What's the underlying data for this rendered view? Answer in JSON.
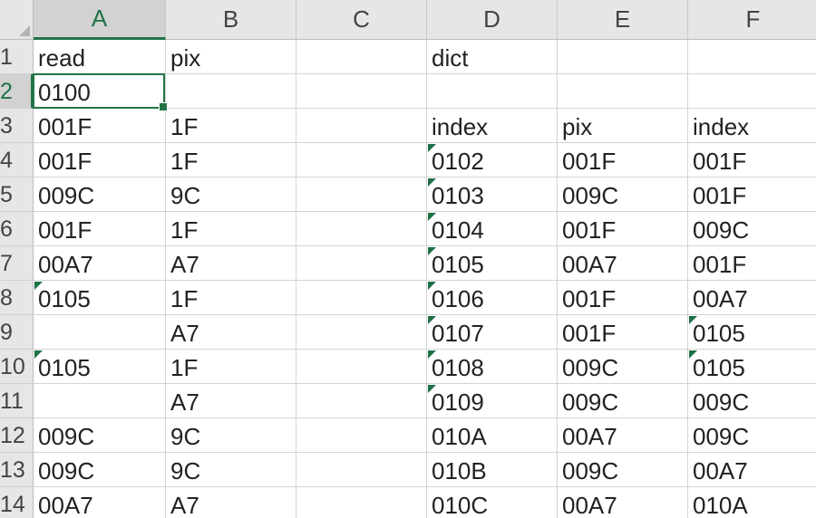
{
  "columns": [
    {
      "label": "A",
      "width": 146,
      "active": true
    },
    {
      "label": "B",
      "width": 144,
      "active": false
    },
    {
      "label": "C",
      "width": 144,
      "active": false
    },
    {
      "label": "D",
      "width": 144,
      "active": false
    },
    {
      "label": "E",
      "width": 144,
      "active": false
    },
    {
      "label": "F",
      "width": 144,
      "active": false
    }
  ],
  "rows": [
    {
      "num": "1",
      "active": false,
      "cells": [
        {
          "v": "read"
        },
        {
          "v": "pix"
        },
        {
          "v": ""
        },
        {
          "v": "dict"
        },
        {
          "v": ""
        },
        {
          "v": ""
        }
      ]
    },
    {
      "num": "2",
      "active": true,
      "cells": [
        {
          "v": "0100"
        },
        {
          "v": ""
        },
        {
          "v": ""
        },
        {
          "v": ""
        },
        {
          "v": ""
        },
        {
          "v": ""
        }
      ]
    },
    {
      "num": "3",
      "active": false,
      "cells": [
        {
          "v": "001F"
        },
        {
          "v": "1F"
        },
        {
          "v": ""
        },
        {
          "v": "index"
        },
        {
          "v": "pix"
        },
        {
          "v": "index"
        }
      ]
    },
    {
      "num": "4",
      "active": false,
      "cells": [
        {
          "v": "001F"
        },
        {
          "v": "1F"
        },
        {
          "v": ""
        },
        {
          "v": "0102",
          "f": true
        },
        {
          "v": "001F"
        },
        {
          "v": "001F"
        }
      ]
    },
    {
      "num": "5",
      "active": false,
      "cells": [
        {
          "v": "009C"
        },
        {
          "v": "9C"
        },
        {
          "v": ""
        },
        {
          "v": "0103",
          "f": true
        },
        {
          "v": "009C"
        },
        {
          "v": "001F"
        }
      ]
    },
    {
      "num": "6",
      "active": false,
      "cells": [
        {
          "v": "001F"
        },
        {
          "v": "1F"
        },
        {
          "v": ""
        },
        {
          "v": "0104",
          "f": true
        },
        {
          "v": "001F"
        },
        {
          "v": "009C"
        }
      ]
    },
    {
      "num": "7",
      "active": false,
      "cells": [
        {
          "v": "00A7"
        },
        {
          "v": "A7"
        },
        {
          "v": ""
        },
        {
          "v": "0105",
          "f": true
        },
        {
          "v": "00A7"
        },
        {
          "v": "001F"
        }
      ]
    },
    {
      "num": "8",
      "active": false,
      "cells": [
        {
          "v": "0105",
          "f": true
        },
        {
          "v": "1F"
        },
        {
          "v": ""
        },
        {
          "v": "0106",
          "f": true
        },
        {
          "v": "001F"
        },
        {
          "v": "00A7"
        }
      ]
    },
    {
      "num": "9",
      "active": false,
      "cells": [
        {
          "v": ""
        },
        {
          "v": "A7"
        },
        {
          "v": ""
        },
        {
          "v": "0107",
          "f": true
        },
        {
          "v": "001F"
        },
        {
          "v": "0105",
          "f": true
        }
      ]
    },
    {
      "num": "10",
      "active": false,
      "cells": [
        {
          "v": "0105",
          "f": true
        },
        {
          "v": "1F"
        },
        {
          "v": ""
        },
        {
          "v": "0108",
          "f": true
        },
        {
          "v": "009C"
        },
        {
          "v": "0105",
          "f": true
        }
      ]
    },
    {
      "num": "11",
      "active": false,
      "cells": [
        {
          "v": ""
        },
        {
          "v": "A7"
        },
        {
          "v": ""
        },
        {
          "v": "0109",
          "f": true
        },
        {
          "v": "009C"
        },
        {
          "v": "009C"
        }
      ]
    },
    {
      "num": "12",
      "active": false,
      "cells": [
        {
          "v": "009C"
        },
        {
          "v": "9C"
        },
        {
          "v": ""
        },
        {
          "v": "010A"
        },
        {
          "v": "00A7"
        },
        {
          "v": "009C"
        }
      ]
    },
    {
      "num": "13",
      "active": false,
      "cells": [
        {
          "v": "009C"
        },
        {
          "v": "9C"
        },
        {
          "v": ""
        },
        {
          "v": "010B"
        },
        {
          "v": "009C"
        },
        {
          "v": "00A7"
        }
      ]
    },
    {
      "num": "14",
      "active": false,
      "cells": [
        {
          "v": "00A7"
        },
        {
          "v": "A7"
        },
        {
          "v": ""
        },
        {
          "v": "010C"
        },
        {
          "v": "00A7"
        },
        {
          "v": "010A"
        }
      ]
    }
  ],
  "colors": {
    "accent": "#217346",
    "text_flag": "#1e7145"
  }
}
